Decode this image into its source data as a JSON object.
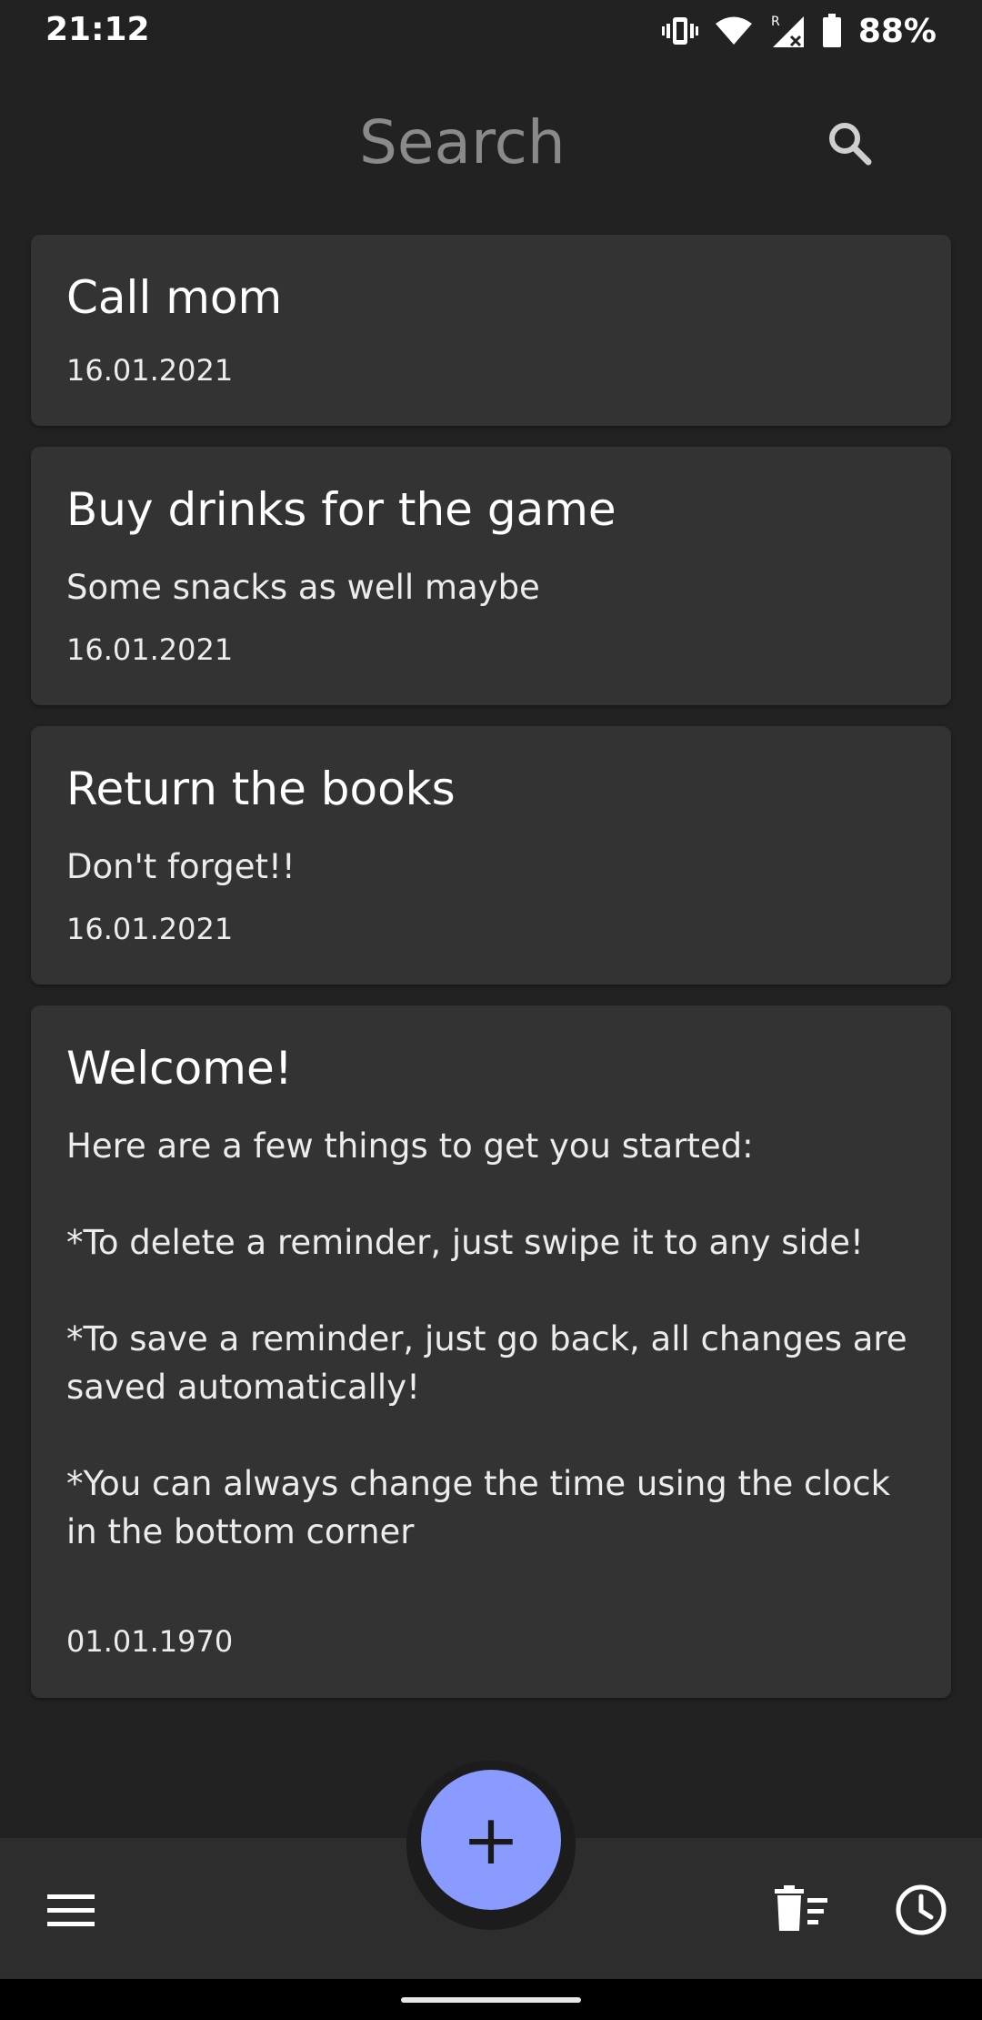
{
  "status_bar": {
    "time": "21:12",
    "battery": "88%",
    "icons": [
      "vibrate-icon",
      "wifi-icon",
      "signal-roaming-icon",
      "battery-icon"
    ]
  },
  "search": {
    "placeholder": "Search",
    "icon": "search-icon"
  },
  "reminders": [
    {
      "title": "Call mom",
      "body": "",
      "date": "16.01.2021"
    },
    {
      "title": "Buy drinks for the game",
      "body": "Some snacks as well maybe",
      "date": "16.01.2021"
    },
    {
      "title": "Return the books",
      "body": "Don't forget!!",
      "date": "16.01.2021"
    },
    {
      "title": "Welcome!",
      "body": "Here are a few things to get you started:\n\n*To delete a reminder, just swipe it to any side!\n\n*To save a reminder, just go back, all changes are saved automatically!\n\n*You can always change the time using the clock in the bottom corner",
      "date": "01.01.1970"
    }
  ],
  "fab": {
    "label": "+"
  },
  "bottom_bar": {
    "icons": [
      "menu-icon",
      "delete-sweep-icon",
      "clock-icon"
    ]
  },
  "colors": {
    "background": "#222222",
    "card": "#333333",
    "accent": "#8a9bff",
    "bottom_bar": "#2d2d2d"
  }
}
